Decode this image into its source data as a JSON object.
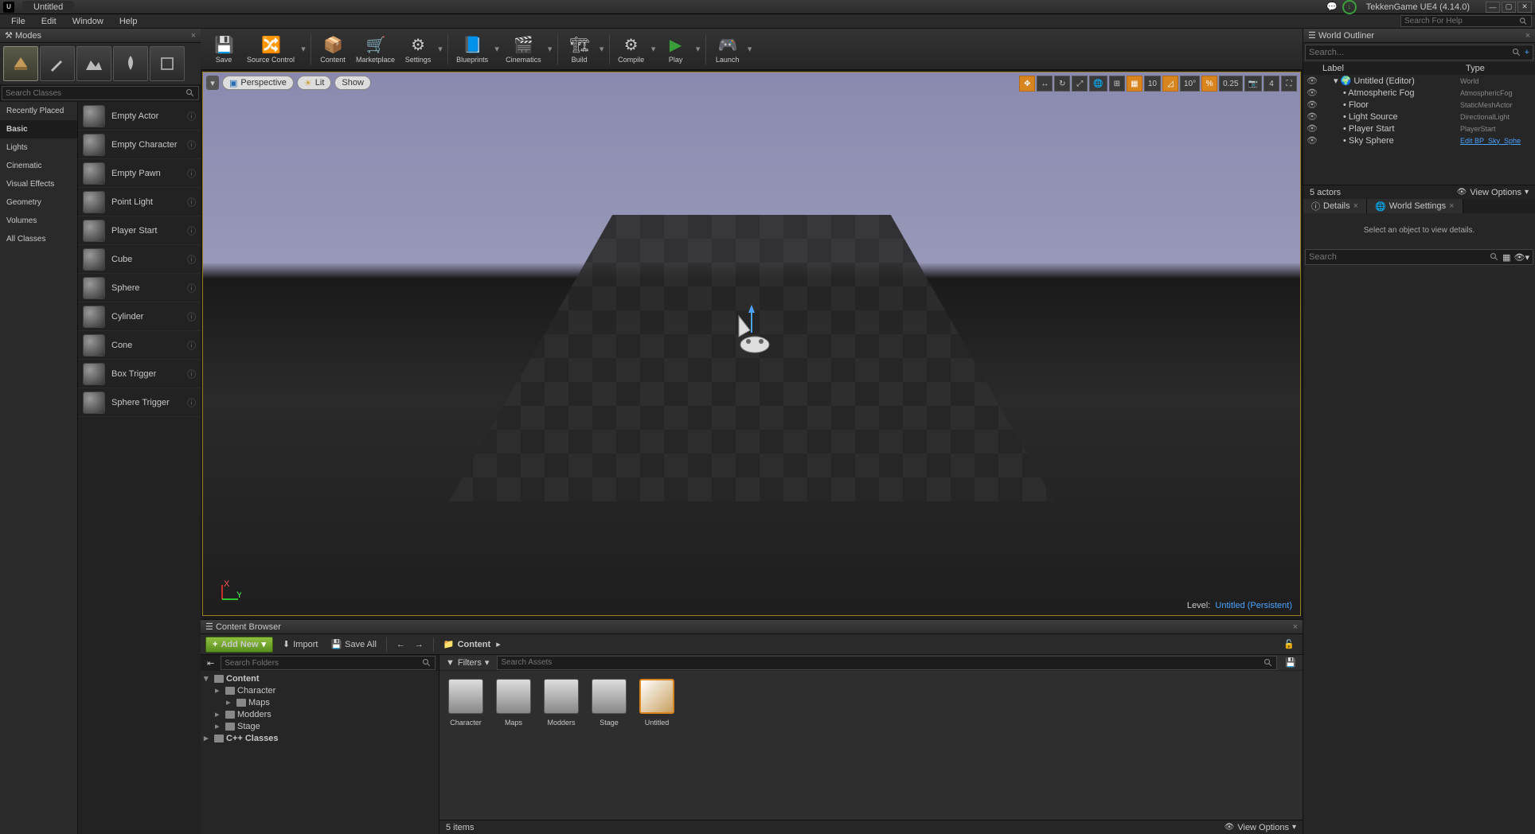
{
  "title_tab": "Untitled",
  "app_title": "TekkenGame UE4 (4.14.0)",
  "menubar": [
    "File",
    "Edit",
    "Window",
    "Help"
  ],
  "help_search_placeholder": "Search For Help",
  "modes": {
    "panel_title": "Modes",
    "search_placeholder": "Search Classes",
    "categories": [
      "Recently Placed",
      "Basic",
      "Lights",
      "Cinematic",
      "Visual Effects",
      "Geometry",
      "Volumes",
      "All Classes"
    ],
    "selected_category": "Basic",
    "actors": [
      "Empty Actor",
      "Empty Character",
      "Empty Pawn",
      "Point Light",
      "Player Start",
      "Cube",
      "Sphere",
      "Cylinder",
      "Cone",
      "Box Trigger",
      "Sphere Trigger"
    ]
  },
  "toolbar": [
    {
      "label": "Save",
      "dd": false
    },
    {
      "label": "Source Control",
      "dd": true
    },
    {
      "sep": true
    },
    {
      "label": "Content",
      "dd": false
    },
    {
      "label": "Marketplace",
      "dd": false
    },
    {
      "label": "Settings",
      "dd": true
    },
    {
      "sep": true
    },
    {
      "label": "Blueprints",
      "dd": true
    },
    {
      "label": "Cinematics",
      "dd": true
    },
    {
      "sep": true
    },
    {
      "label": "Build",
      "dd": true
    },
    {
      "sep": true
    },
    {
      "label": "Compile",
      "dd": true
    },
    {
      "label": "Play",
      "dd": true
    },
    {
      "sep": true
    },
    {
      "label": "Launch",
      "dd": true
    }
  ],
  "viewport": {
    "perspective": "Perspective",
    "lit": "Lit",
    "show": "Show",
    "snap_translate": "10",
    "snap_rotate": "10°",
    "snap_scale": "0.25",
    "cam_speed": "4",
    "level_label": "Level:",
    "level_name": "Untitled (Persistent)"
  },
  "content_browser": {
    "panel_title": "Content Browser",
    "add_new": "Add New",
    "import": "Import",
    "save_all": "Save All",
    "path": "Content",
    "tree_search_placeholder": "Search Folders",
    "asset_search_placeholder": "Search Assets",
    "filters": "Filters",
    "tree": [
      {
        "label": "Content",
        "depth": 0,
        "bold": true,
        "exp": true
      },
      {
        "label": "Character",
        "depth": 1
      },
      {
        "label": "Maps",
        "depth": 2
      },
      {
        "label": "Modders",
        "depth": 1
      },
      {
        "label": "Stage",
        "depth": 1
      },
      {
        "label": "C++ Classes",
        "depth": 0,
        "bold": true
      }
    ],
    "assets": [
      {
        "name": "Character",
        "folder": true
      },
      {
        "name": "Maps",
        "folder": true
      },
      {
        "name": "Modders",
        "folder": true
      },
      {
        "name": "Stage",
        "folder": true
      },
      {
        "name": "Untitled",
        "folder": false,
        "selected": true
      }
    ],
    "status": "5 items",
    "view_options": "View Options"
  },
  "outliner": {
    "panel_title": "World Outliner",
    "search_placeholder": "Search...",
    "col_label": "Label",
    "col_type": "Type",
    "rows": [
      {
        "label": "Untitled (Editor)",
        "type": "World",
        "depth": 0
      },
      {
        "label": "Atmospheric Fog",
        "type": "AtmosphericFog",
        "depth": 1
      },
      {
        "label": "Floor",
        "type": "StaticMeshActor",
        "depth": 1
      },
      {
        "label": "Light Source",
        "type": "DirectionalLight",
        "depth": 1
      },
      {
        "label": "Player Start",
        "type": "PlayerStart",
        "depth": 1
      },
      {
        "label": "Sky Sphere",
        "type": "Edit BP_Sky_Sphe",
        "depth": 1,
        "link": true
      }
    ],
    "status": "5 actors",
    "view_options": "View Options"
  },
  "details": {
    "tab1": "Details",
    "tab2": "World Settings",
    "message": "Select an object to view details.",
    "search_placeholder": "Search"
  }
}
